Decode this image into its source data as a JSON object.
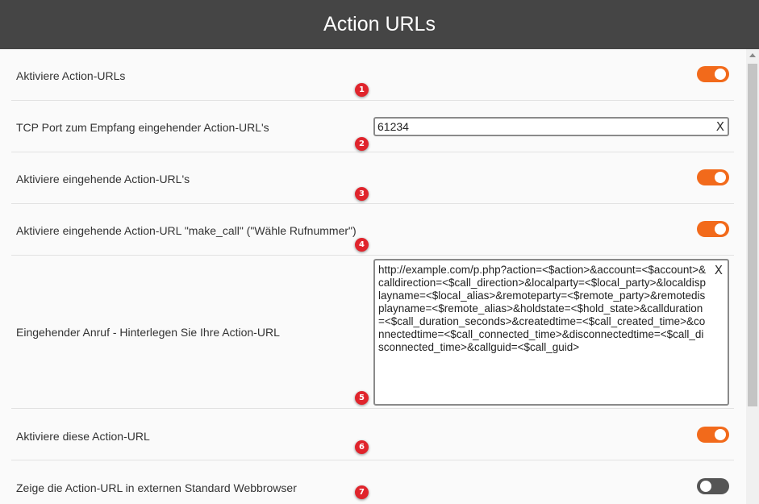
{
  "header": {
    "title": "Action URLs"
  },
  "settings": [
    {
      "label": "Aktiviere Action-URLs",
      "control": "toggle",
      "state": "on",
      "badge": "1"
    },
    {
      "label": "TCP Port zum Empfang eingehender Action-URL's",
      "control": "text",
      "value": "61234",
      "badge": "2"
    },
    {
      "label": "Aktiviere eingehende Action-URL's",
      "control": "toggle",
      "state": "on",
      "badge": "3"
    },
    {
      "label": "Aktiviere eingehende Action-URL \"make_call\" (\"Wähle Rufnummer\")",
      "control": "toggle",
      "state": "on",
      "badge": "4"
    },
    {
      "label": "Eingehender Anruf - Hinterlegen Sie Ihre Action-URL",
      "control": "textarea",
      "value": "http://example.com/p.php?action=<$action>&account=<$account>&calldirection=<$call_direction>&localparty=<$local_party>&localdisplayname=<$local_alias>&remoteparty=<$remote_party>&remotedisplayname=<$remote_alias>&holdstate=<$hold_state>&callduration=<$call_duration_seconds>&createdtime=<$call_created_time>&connectedtime=<$call_connected_time>&disconnectedtime=<$call_disconnected_time>&callguid=<$call_guid>",
      "badge": "5"
    },
    {
      "label": "Aktiviere diese Action-URL",
      "control": "toggle",
      "state": "on",
      "badge": "6"
    },
    {
      "label": "Zeige die Action-URL in externen Standard Webbrowser",
      "control": "toggle",
      "state": "off",
      "badge": "7"
    }
  ],
  "clear_glyph": "X",
  "colors": {
    "toggle_on": "#f26a1b",
    "toggle_off": "#555555",
    "badge": "#e0242c",
    "header_bg": "#454545"
  }
}
